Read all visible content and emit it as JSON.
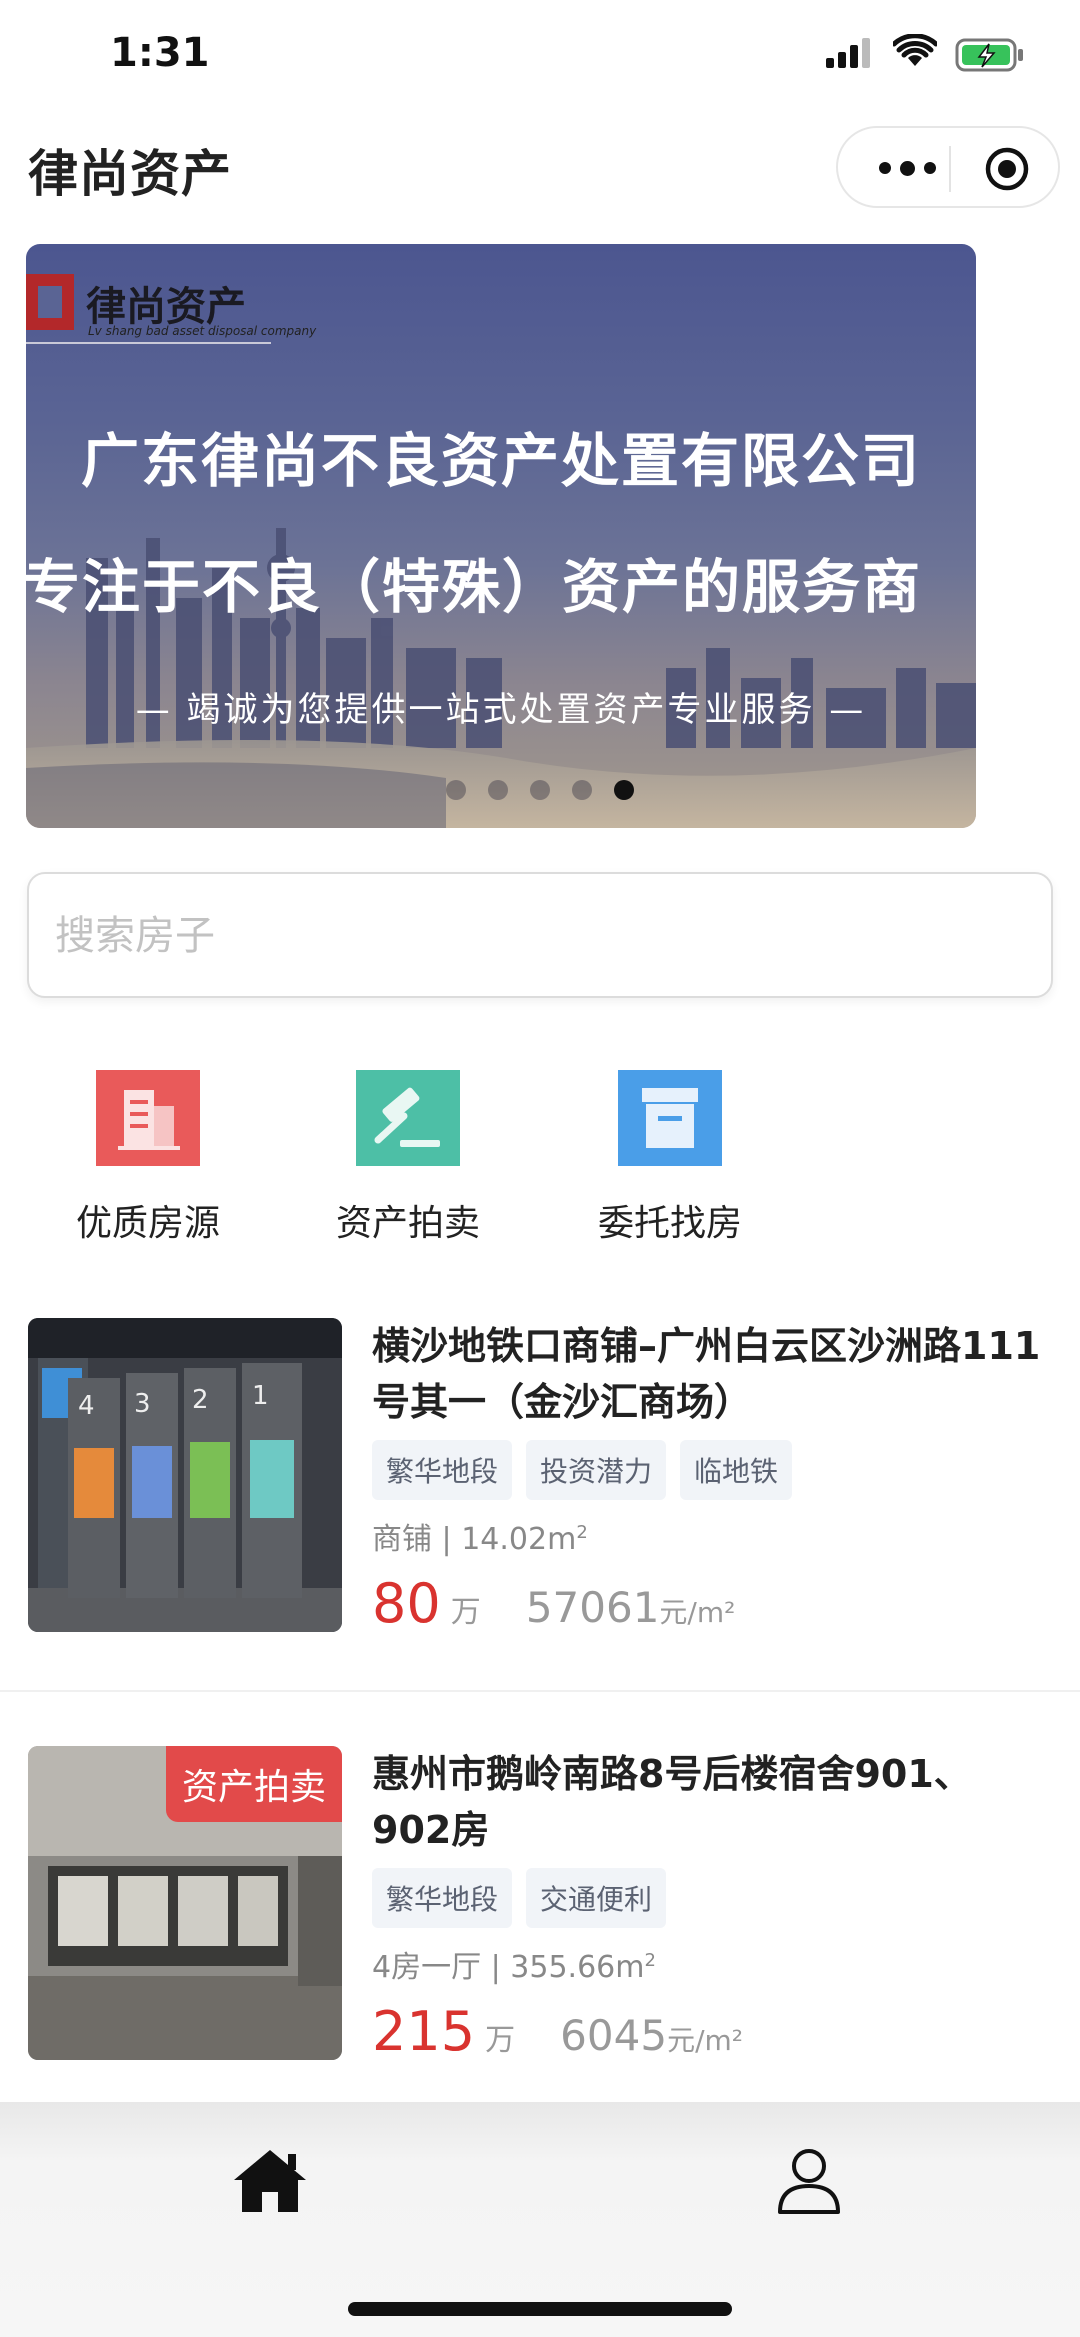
{
  "status_bar": {
    "time": "1:31"
  },
  "nav": {
    "title": "律尚资产"
  },
  "banner": {
    "logo_text": "律尚资产",
    "logo_sub": "Lv shang bad asset disposal company",
    "line1": "广东律尚不良资产处置有限公司",
    "line2": "专注于不良（特殊）资产的服务商",
    "line3": "— 竭诚为您提供一站式处置资产专业服务 —",
    "slides": 5,
    "active_slide": 5
  },
  "search": {
    "placeholder": "搜索房子",
    "value": ""
  },
  "categories": [
    {
      "label": "优质房源",
      "icon": "building-icon",
      "color": "#e95a5a"
    },
    {
      "label": "资产拍卖",
      "icon": "gavel-icon",
      "color": "#4dbfa6"
    },
    {
      "label": "委托找房",
      "icon": "document-icon",
      "color": "#4a9ee8"
    }
  ],
  "listings": [
    {
      "title": "横沙地铁口商铺–广州白云区沙洲路111号其一（金沙汇商场）",
      "tags": [
        "繁华地段",
        "投资潜力",
        "临地铁"
      ],
      "type": "商铺",
      "area": "14.02m",
      "price": "80",
      "price_unit": "万",
      "unit_price": "57061",
      "unit_price_unit": "元/m²",
      "badge": ""
    },
    {
      "title": "惠州市鹅岭南路8号后楼宿舍901、902房",
      "tags": [
        "繁华地段",
        "交通便利"
      ],
      "type": "4房一厅",
      "area": "355.66m",
      "price": "215",
      "price_unit": "万",
      "unit_price": "6045",
      "unit_price_unit": "元/m²",
      "badge": "资产拍卖"
    }
  ],
  "tabbar": {
    "items": [
      "home-icon",
      "user-icon"
    ]
  },
  "colors": {
    "accent_red": "#d9332f",
    "tag_bg": "#f1f4f8"
  }
}
